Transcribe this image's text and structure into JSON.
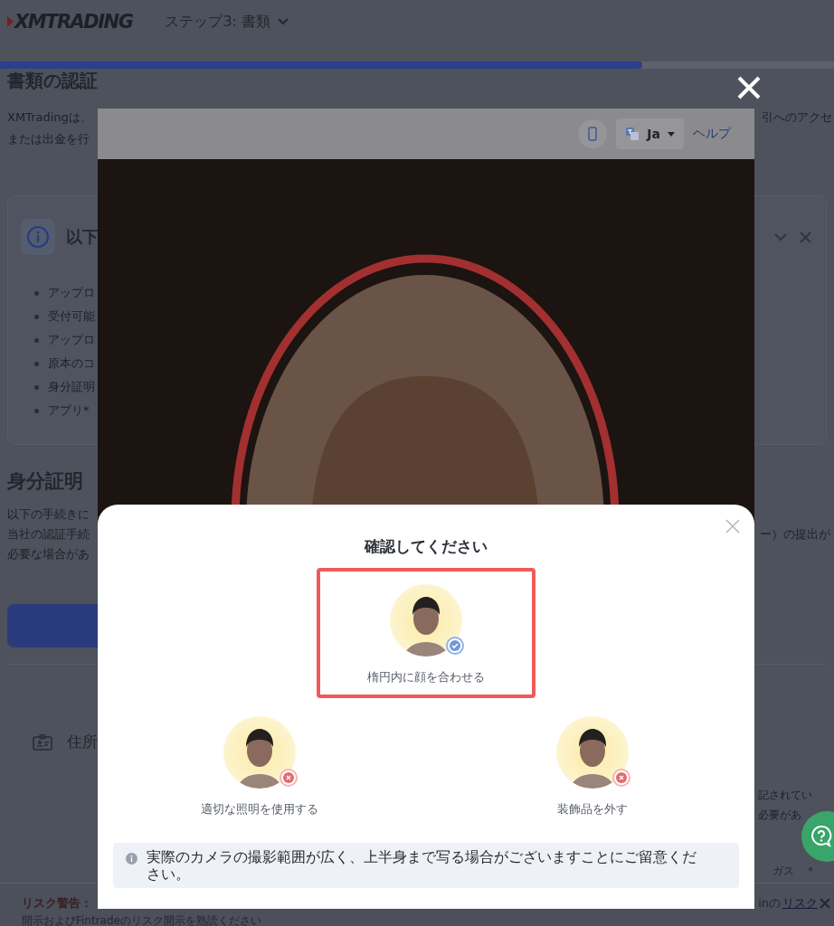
{
  "header": {
    "logo": "XMTRADING",
    "step": "ステップ3: 書類"
  },
  "progress": {
    "level": 0.77
  },
  "page": {
    "heading": "書類の認証",
    "intro": [
      {
        "left": "XMTradingは、",
        "right": "引へのアクセ"
      },
      {
        "left": "または出金を行"
      }
    ],
    "info_card": {
      "title": "以下",
      "items": [
        "アップロ",
        "受付可能",
        "アップロ",
        "原本のコ",
        "身分証明",
        "アプリ*"
      ]
    },
    "id_section": {
      "heading": "身分証明",
      "lines": [
        {
          "left": "以下の手続きに"
        },
        {
          "left": "当社の認証手続",
          "right": "ー）の提出が"
        },
        {
          "left": "必要な場合があ"
        }
      ]
    },
    "address_card": {
      "title": "住所",
      "lines": [
        "記されてい",
        "必要があ"
      ],
      "footnote": "ガス　＊"
    },
    "risk_bar": {
      "label": "リスク警告：",
      "right_text": "inの",
      "right_link": "リスク",
      "line2": "開示およびFintradeのリスク開示を熟読ください"
    }
  },
  "camera": {
    "language": "Ja",
    "help": "ヘルプ"
  },
  "modal": {
    "title": "確認してください",
    "options": [
      {
        "label": "楕円内に顔を合わせる",
        "selected": true,
        "valid": true
      },
      {
        "label": "適切な照明を使用する",
        "selected": false,
        "valid": false
      },
      {
        "label": "装飾品を外す",
        "selected": false,
        "valid": false
      }
    ],
    "note": "実際のカメラの撮影範囲が広く、上半身まで写る場合がございますことにご留意ください。"
  }
}
